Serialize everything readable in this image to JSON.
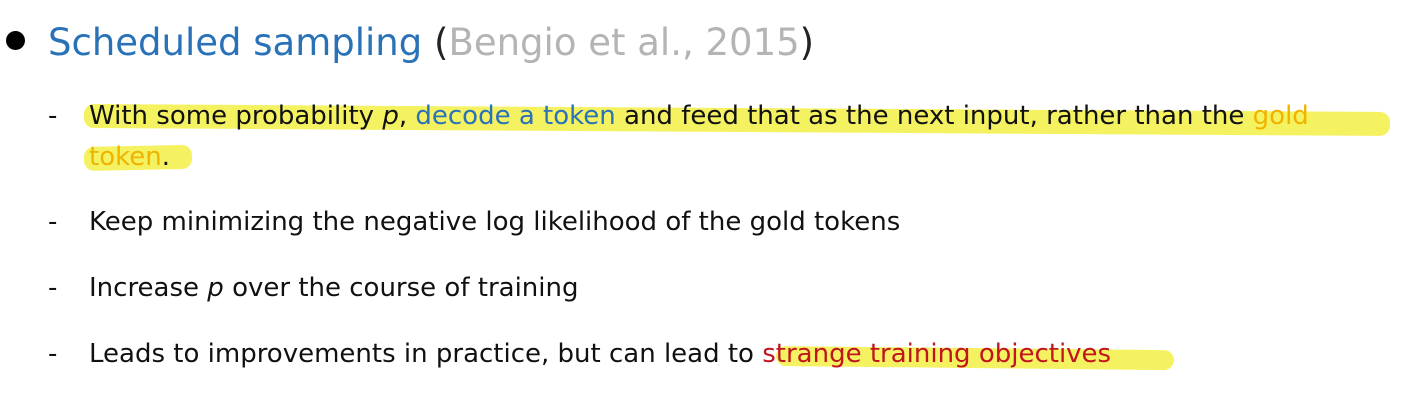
{
  "heading": {
    "title": "Scheduled sampling",
    "open_paren": "(",
    "citation": "Bengio et al., 2015",
    "close_paren": ")"
  },
  "items": [
    {
      "dash": "-",
      "parts": [
        "With some probability ",
        "p",
        ", ",
        "decode a token",
        " and feed that as the next input, rather than the ",
        "gold"
      ],
      "line2": [
        "token",
        "."
      ]
    },
    {
      "dash": "-",
      "text": "Keep minimizing the negative log likelihood of the gold tokens"
    },
    {
      "dash": "-",
      "parts": [
        "Increase ",
        "p",
        " over the course of training"
      ]
    },
    {
      "dash": "-",
      "parts": [
        "Leads to improvements in practice, but can lead to ",
        "strange training objectives"
      ]
    }
  ],
  "colors": {
    "title": "#2a72b8",
    "citation": "#b4b4b4",
    "link_blue": "#2a72b8",
    "gold": "#f0b400",
    "red": "#c0151e",
    "highlighter": "#f3f047"
  }
}
